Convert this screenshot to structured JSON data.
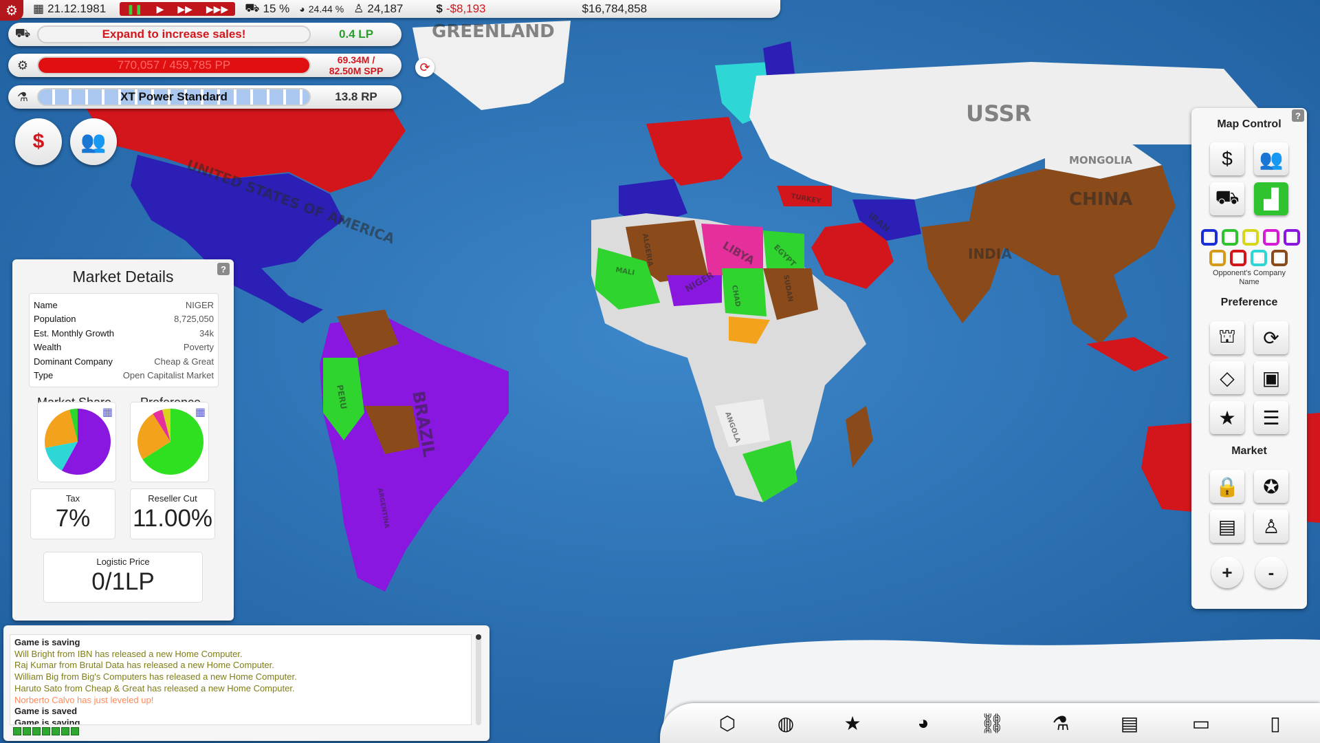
{
  "topbar": {
    "date": "21.12.1981",
    "logistics_pct": "15 %",
    "market_share_pct": "24.44 %",
    "units": "24,187",
    "profit": "-$8,193",
    "money": "$16,784,858"
  },
  "status": {
    "sales": {
      "text": "Expand to increase sales!",
      "value": "0.4 LP"
    },
    "production": {
      "text": "770,057 / 459,785 PP",
      "value_line1": "69.34M /",
      "value_line2": "82.50M SPP"
    },
    "research": {
      "text": "XT Power Standard",
      "value": "13.8 RP"
    }
  },
  "map_labels": {
    "greenland": "GREENLAND",
    "ussr": "USSR",
    "mongolia": "MONGOLIA",
    "china": "CHINA",
    "india": "INDIA",
    "usa": "UNITED STATES OF AMERICA",
    "brazil": "BRAZIL",
    "libya": "LIBYA",
    "niger": "NIGER",
    "egypt": "EGYPT",
    "turkey": "TURKEY",
    "iran": "IRAN",
    "algeria": "ALGERIA",
    "sudan": "SUDAN",
    "chad": "CHAD",
    "mali": "MALI",
    "angola": "ANGOLA",
    "argentina": "ARGENTINA",
    "peru": "PERU"
  },
  "market": {
    "title": "Market Details",
    "details": [
      {
        "key": "Name",
        "value": "NIGER"
      },
      {
        "key": "Population",
        "value": "8,725,050"
      },
      {
        "key": "Est. Monthly Growth",
        "value": "34k"
      },
      {
        "key": "Wealth",
        "value": "Poverty"
      },
      {
        "key": "Dominant Company",
        "value": "Cheap & Great"
      },
      {
        "key": "Type",
        "value": "Open Capitalist Market"
      }
    ],
    "share_label": "Market Share",
    "preference_label": "Preference",
    "tax_label": "Tax",
    "tax_value": "7%",
    "reseller_label": "Reseller Cut",
    "reseller_value": "11.00%",
    "logistic_label": "Logistic Price",
    "logistic_value": "0/1LP"
  },
  "chart_data": [
    {
      "type": "pie",
      "title": "Market Share",
      "values": [
        0.58,
        0.14,
        0.24,
        0.04
      ],
      "colors": [
        "#8a17e0",
        "#2fd6d6",
        "#f2a21b",
        "#2fd42f"
      ]
    },
    {
      "type": "pie",
      "title": "Preference",
      "values": [
        0.66,
        0.25,
        0.05,
        0.04
      ],
      "colors": [
        "#2ee01f",
        "#f2a21b",
        "#e52f9c",
        "#d7d21b"
      ]
    }
  ],
  "log": [
    {
      "kind": "sys",
      "text": "Game is saving"
    },
    {
      "kind": "news",
      "text": "Will Bright from IBN has released a new Home Computer."
    },
    {
      "kind": "news",
      "text": "Raj Kumar from Brutal Data has released a new Home Computer."
    },
    {
      "kind": "news",
      "text": "William Big from Big's Computers has released a new Home Computer."
    },
    {
      "kind": "news",
      "text": "Haruto Sato from Cheap & Great has released a new Home Computer."
    },
    {
      "kind": "lvl",
      "text": "Norberto Calvo has just leveled up!"
    },
    {
      "kind": "sys",
      "text": "Game is saved"
    },
    {
      "kind": "sys",
      "text": "Game is saving"
    }
  ],
  "map_control": {
    "title": "Map Control",
    "opponent_label_1": "Opponent's Company",
    "opponent_label_2": "Name",
    "preference_title": "Preference",
    "market_title": "Market",
    "zoom_in": "+",
    "zoom_out": "-",
    "swatches": [
      "#1a2fd6",
      "#2fc42f",
      "#d6d61a",
      "#d61ad6",
      "#8a17e0",
      "#d69a1a",
      "#d3161b",
      "#2fd6d6",
      "#8a4a1a"
    ]
  },
  "colors": {
    "ocean": "#2a6fb3",
    "accent_red": "#d3161b",
    "ok_green": "#2a9d2a"
  }
}
